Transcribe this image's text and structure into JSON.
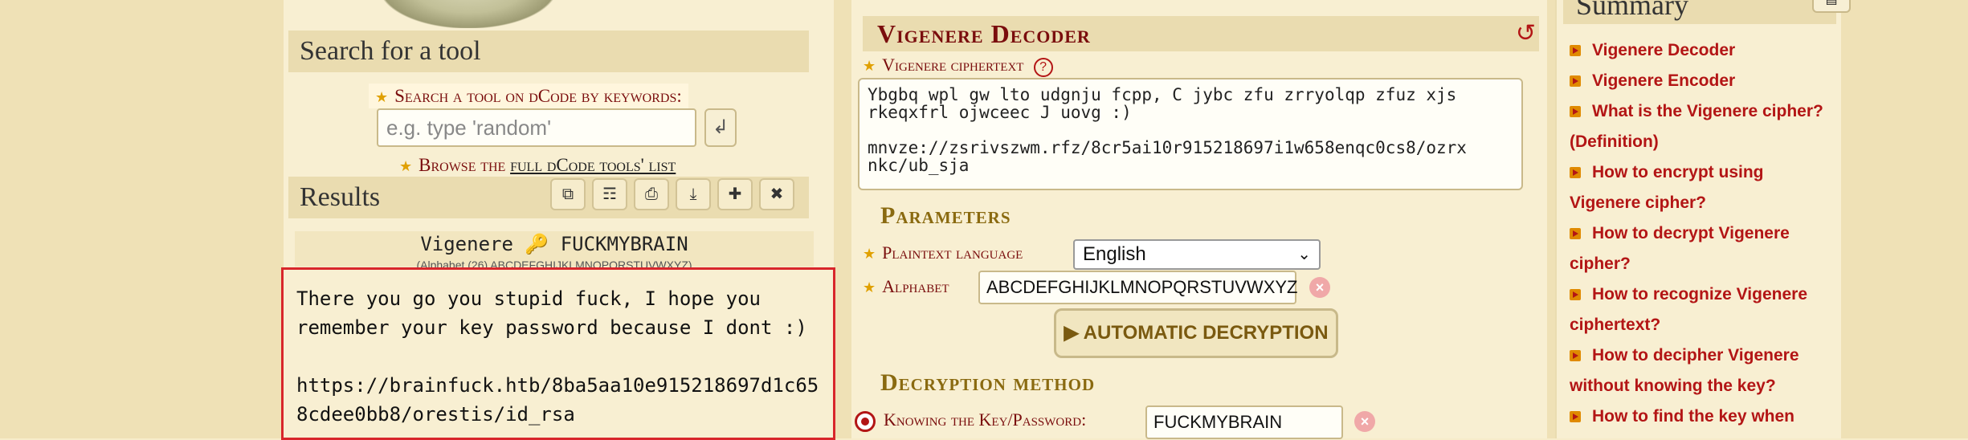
{
  "left": {
    "search_heading": "Search for a tool",
    "search_label": "Search a tool on dCode by keywords:",
    "search_placeholder": "e.g. type 'random'",
    "search_go_icon": "↲",
    "browse_prefix": "Browse the ",
    "browse_link": "full dCode tools' list",
    "results_heading": "Results",
    "toolbar_icons": [
      "copy-icon",
      "bookmark-icon",
      "print-icon",
      "download-icon",
      "pin-icon",
      "close-icon"
    ],
    "toolbar_glyphs": [
      "⧉",
      "☶",
      "⎙",
      "⤓",
      "✚",
      "✖"
    ],
    "result_title": "Vigenere 🔑 FUCKMYBRAIN",
    "result_alphabet": "(Alphabet (26) ABCDEFGHIJKLMNOPQRSTUVWXYZ)",
    "result_text": "There you go you stupid fuck, I hope you\nremember your key password because I dont :)\n\nhttps://brainfuck.htb/8ba5aa10e915218697d1c65\n8cdee0bb8/orestis/id_rsa"
  },
  "middle": {
    "title": "Vigenere Decoder",
    "reset_icon": "↺",
    "ciphertext_label": "Vigenere ciphertext",
    "help_icon": "?",
    "ciphertext": "Ybgbq wpl gw lto udgnju fcpp, C jybc zfu zrryolqp zfuz xjs\nrkeqxfrl ojwceec J uovg :)\n\nmnvze://zsrivszwm.rfz/8cr5ai10r915218697i1w658enqc0cs8/ozrx\nnkc/ub_sja",
    "params_title": "Parameters",
    "lang_label": "Plaintext language",
    "lang_value": "English",
    "alphabet_label": "Alphabet",
    "alphabet_value": "ABCDEFGHIJKLMNOPQRSTUVWXYZ",
    "auto_button": "▶ AUTOMATIC DECRYPTION",
    "method_title": "Decryption method",
    "key_label": "Knowing the Key/Password:",
    "key_value": "FUCKMYBRAIN"
  },
  "summary": {
    "title": "Summary",
    "items": [
      "Vigenere Decoder",
      "Vigenere Encoder",
      "What is the Vigenere cipher? (Definition)",
      "How to encrypt using Vigenere cipher?",
      "How to decrypt Vigenere cipher?",
      "How to recognize Vigenere ciphertext?",
      "How to decipher Vigenere without knowing the key?",
      "How to find the key when"
    ]
  },
  "colors": {
    "accent": "#7a0d0d",
    "link": "#b31515",
    "highlight_border": "#d8262b",
    "page_bg": "#f7ecca"
  }
}
